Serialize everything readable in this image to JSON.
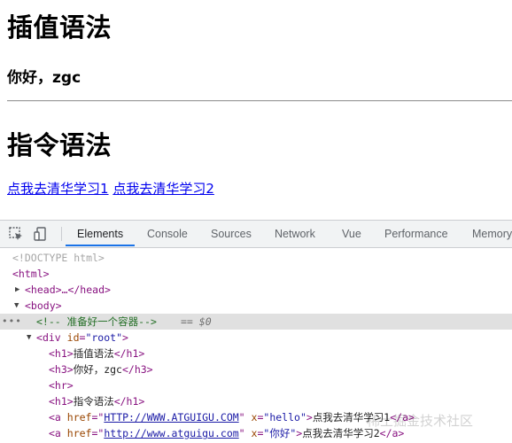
{
  "page": {
    "heading1": "插值语法",
    "greeting": "你好，zgc",
    "heading2": "指令语法",
    "link1": "点我去清华学习1",
    "link2": "点我去清华学习2"
  },
  "devtools": {
    "tabs": [
      "Elements",
      "Console",
      "Sources",
      "Network",
      "Vue",
      "Performance",
      "Memory"
    ],
    "active_tab": "Elements",
    "icons": [
      "inspect-element-icon",
      "device-toggle-icon"
    ]
  },
  "tree": {
    "doctype": "<!DOCTYPE html>",
    "html_open": "<html>",
    "head_collapsed": "<head>…</head>",
    "body_open": "<body>",
    "comment": "<!-- 准备好一个容器-->",
    "comment_suffix": "== $0",
    "div_tag": "div",
    "div_attr": "id",
    "div_val": "\"root\"",
    "h1_a": "插值语法",
    "h3_a": "你好，zgc",
    "hr": "<hr>",
    "h1_b": "指令语法",
    "a1_href": "HTTP://WWW.ATGUIGU.COM",
    "a1_x": "\"hello\"",
    "a1_text": "点我去清华学习1",
    "a2_href": "http://www.atguigu.com",
    "a2_x": "\"你好\"",
    "a2_text": "点我去清华学习2"
  },
  "watermark": "稀土掘金技术社区"
}
